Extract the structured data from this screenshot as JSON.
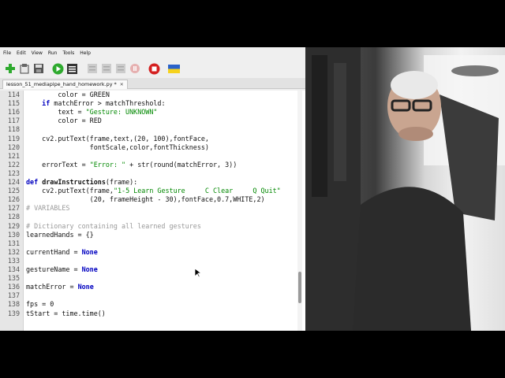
{
  "menu": [
    "File",
    "Edit",
    "View",
    "Run",
    "Tools",
    "Help"
  ],
  "toolbar": {
    "buttons": [
      {
        "name": "new-file-icon",
        "enabled": true
      },
      {
        "name": "open-file-icon",
        "enabled": true
      },
      {
        "name": "save-file-icon",
        "enabled": true
      },
      {
        "name": "run-icon",
        "enabled": true
      },
      {
        "name": "debug-icon",
        "enabled": true
      },
      {
        "name": "step-over-icon",
        "enabled": false
      },
      {
        "name": "step-into-icon",
        "enabled": false
      },
      {
        "name": "step-out-icon",
        "enabled": false
      },
      {
        "name": "resume-icon",
        "enabled": false
      },
      {
        "name": "stop-icon",
        "enabled": true
      },
      {
        "name": "ukraine-flag-icon",
        "enabled": true
      }
    ],
    "colors": {
      "run": "#2eaa2e",
      "stop": "#d42020",
      "flag_blue": "#2a62c9",
      "flag_yellow": "#f6d21c"
    }
  },
  "tab": {
    "label": "lesson_51_mediapipe_hand_homework.py *",
    "close": "✕"
  },
  "code_lines": [
    {
      "n": "114",
      "text": "        color = GREEN"
    },
    {
      "n": "115",
      "text": "    if matchError > matchThreshold:"
    },
    {
      "n": "116",
      "text": "        text = \"Gesture: UNKNOWN\""
    },
    {
      "n": "117",
      "text": "        color = RED"
    },
    {
      "n": "118",
      "text": ""
    },
    {
      "n": "119",
      "text": "    cv2.putText(frame,text,(20, 100),fontFace,"
    },
    {
      "n": "120",
      "text": "                fontScale,color,fontThickness)"
    },
    {
      "n": "121",
      "text": ""
    },
    {
      "n": "122",
      "text": "    errorText = \"Error: \" + str(round(matchError, 3))"
    },
    {
      "n": "123",
      "text": ""
    },
    {
      "n": "124",
      "text": "def drawInstructions(frame):"
    },
    {
      "n": "125",
      "text": "    cv2.putText(frame,\"1-5 Learn Gesture     C Clear     Q Quit\""
    },
    {
      "n": "126",
      "text": "                (20, frameHeight - 30),fontFace,0.7,WHITE,2)"
    },
    {
      "n": "127",
      "text": "# VARIABLES"
    },
    {
      "n": "128",
      "text": ""
    },
    {
      "n": "129",
      "text": "# Dictionary containing all learned gestures"
    },
    {
      "n": "130",
      "text": "learnedHands = {}"
    },
    {
      "n": "131",
      "text": ""
    },
    {
      "n": "132",
      "text": "currentHand = None"
    },
    {
      "n": "133",
      "text": ""
    },
    {
      "n": "134",
      "text": "gestureName = None"
    },
    {
      "n": "135",
      "text": ""
    },
    {
      "n": "136",
      "text": "matchError = None"
    },
    {
      "n": "137",
      "text": ""
    },
    {
      "n": "138",
      "text": "fps = 0"
    },
    {
      "n": "139",
      "text": "tStart = time.time()"
    }
  ]
}
